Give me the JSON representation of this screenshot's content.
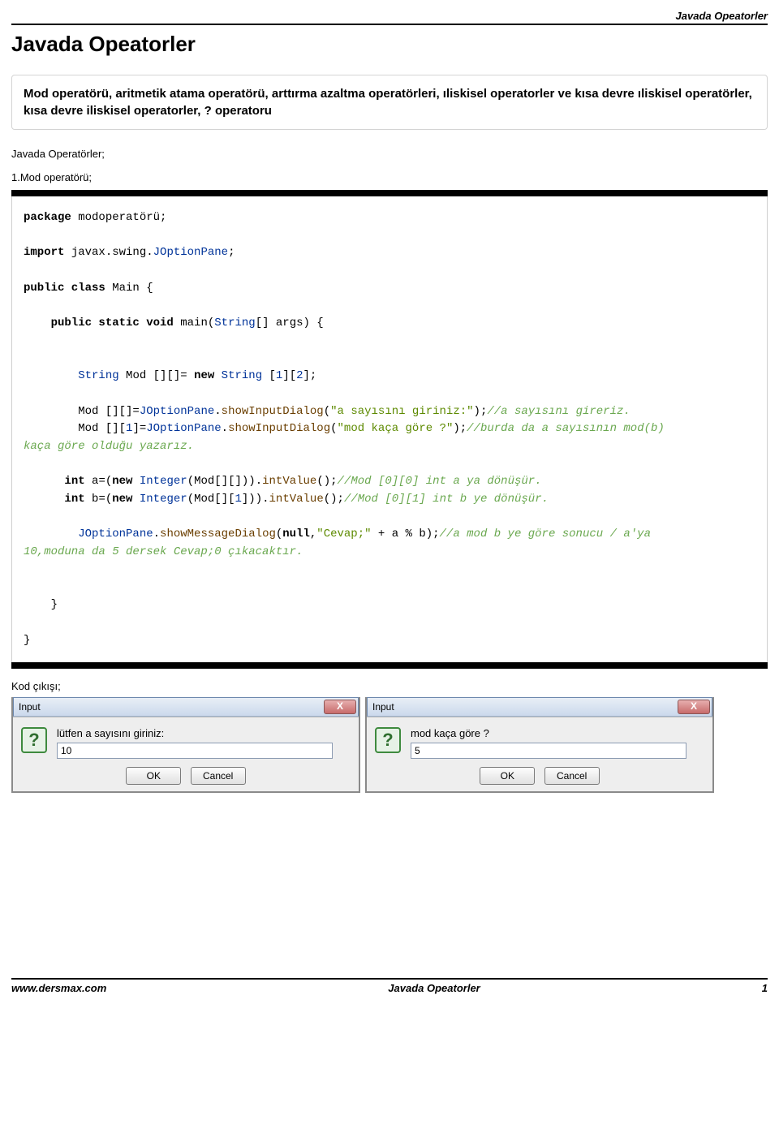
{
  "header": {
    "top_right_label": "Javada Opeatorler",
    "title": "Javada Opeatorler"
  },
  "intro": "Mod operatörü, aritmetik atama operatörü, arttırma azaltma operatörleri, ıliskisel operatorler ve kısa devre ıliskisel operatörler, kısa devre iliskisel operatorler, ? operatoru",
  "para1": "Javada Operatörler;",
  "para2": "1.Mod operatörü;",
  "code": {
    "l1_kw": "package",
    "l1_rest": " modoperatörü;",
    "l2_kw": "import",
    "l2_pkg": " javax.swing.",
    "l2_cls": "JOptionPane",
    "l2_semi": ";",
    "l3a": "public class",
    "l3b": " Main {",
    "l4a": "    public static void",
    "l4b": " main(",
    "l4c": "String",
    "l4d": "[] args) {",
    "l5a": "        ",
    "l5b": "String",
    "l5c": " Mod [][]= ",
    "l5d": "new",
    "l5e": " String",
    "l5f": " [",
    "l5g": "1",
    "l5h": "][",
    "l5i": "2",
    "l5j": "];",
    "l6a": "        Mod [][]=",
    "l6b": "JOptionPane",
    "l6c": ".",
    "l6d": "showInputDialog",
    "l6e": "(",
    "l6f": "\"a sayısını giriniz:\"",
    "l6g": ");",
    "l6h": "//a sayısını gireriz.",
    "l7a": "        Mod [][",
    "l7a2": "1",
    "l7a3": "]=",
    "l7b": "JOptionPane",
    "l7c": ".",
    "l7d": "showInputDialog",
    "l7e": "(",
    "l7f": "\"mod kaça göre ?\"",
    "l7g": ");",
    "l7h": "//burda da a sayısının mod(b)",
    "l7i": "kaça göre olduğu yazarız.",
    "l8a": "      int",
    "l8b": " a=(",
    "l8c": "new",
    "l8d": " Integer",
    "l8e": "(Mod[][])).",
    "l8f": "intValue",
    "l8g": "();",
    "l8h": "//Mod [0][0] int a ya dönüşür.",
    "l9a": "      int",
    "l9b": " b=(",
    "l9c": "new",
    "l9d": " Integer",
    "l9e": "(Mod[][",
    "l9e2": "1",
    "l9e3": "])).",
    "l9f": "intValue",
    "l9g": "();",
    "l9h": "//Mod [0][1] int b ye dönüşür.",
    "l10a": "        ",
    "l10b": "JOptionPane",
    "l10c": ".",
    "l10d": "showMessageDialog",
    "l10e": "(",
    "l10f": "null",
    "l10g": ",",
    "l10h": "\"Cevap;\"",
    "l10i": " + a % b);",
    "l10j": "//a mod b ye göre sonucu / a'ya",
    "l10k": "10,moduna da 5 dersek Cevap;0 çıkacaktır.",
    "l11": "    }",
    "l12": "}"
  },
  "output_label": "Kod çıkışı;",
  "dialog1": {
    "title": "Input",
    "close": "X",
    "message": "lütfen a sayısını giriniz:",
    "value": "10",
    "ok": "OK",
    "cancel": "Cancel"
  },
  "dialog2": {
    "title": "Input",
    "close": "X",
    "message": "mod kaça göre ?",
    "value": "5",
    "ok": "OK",
    "cancel": "Cancel"
  },
  "footer": {
    "left": "www.dersmax.com",
    "center": "Javada Opeatorler",
    "right": "1"
  }
}
